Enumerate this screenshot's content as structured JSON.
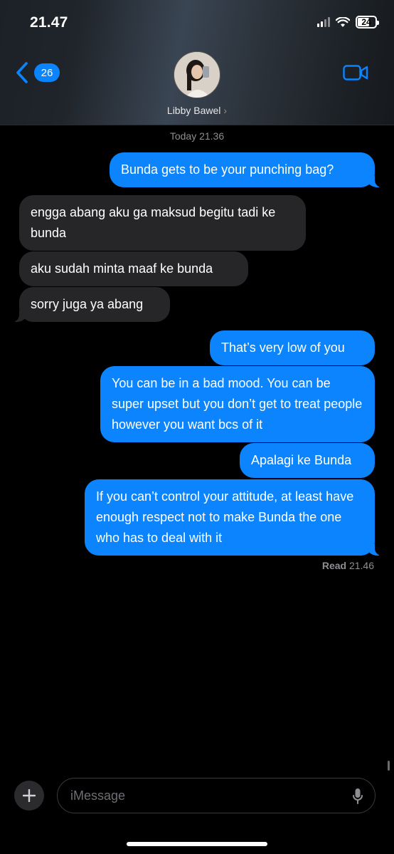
{
  "status": {
    "time": "21.47",
    "battery": "24"
  },
  "nav": {
    "back_count": "26",
    "contact_name": "Libby Bawel",
    "chevron": "›"
  },
  "timestamp": "Today 21.36",
  "messages": [
    {
      "dir": "out",
      "text": "Bunda gets to be your punching bag?"
    },
    {
      "dir": "in",
      "text": "engga abang aku ga maksud begitu tadi ke bunda"
    },
    {
      "dir": "in",
      "text": "aku sudah minta maaf ke bunda"
    },
    {
      "dir": "in",
      "text": "sorry juga ya abang"
    },
    {
      "dir": "out",
      "text": "That’s very low of you"
    },
    {
      "dir": "out",
      "text": "You can be in a bad mood. You can be super upset but you don’t get to treat people however you want bcs of it"
    },
    {
      "dir": "out",
      "text": "Apalagi ke Bunda"
    },
    {
      "dir": "out",
      "text": "If you can’t control your attitude, at least have enough respect not to make Bunda the one who has to deal with it"
    }
  ],
  "read_receipt": {
    "label": "Read",
    "time": "21.46"
  },
  "composer": {
    "placeholder": "iMessage"
  },
  "colors": {
    "outgoing": "#0b84fe",
    "incoming": "#262629",
    "accent": "#0a84ff"
  }
}
